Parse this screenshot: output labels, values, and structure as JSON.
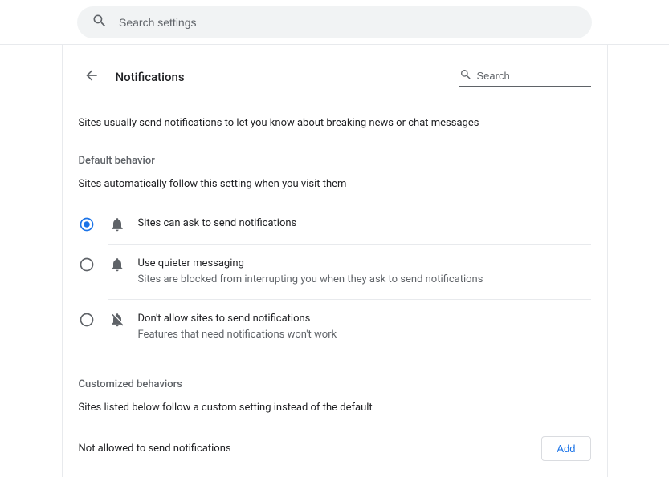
{
  "topSearch": {
    "placeholder": "Search settings"
  },
  "header": {
    "title": "Notifications",
    "searchPlaceholder": "Search"
  },
  "intro": "Sites usually send notifications to let you know about breaking news or chat messages",
  "defaultBehavior": {
    "title": "Default behavior",
    "subtitle": "Sites automatically follow this setting when you visit them",
    "options": [
      {
        "title": "Sites can ask to send notifications",
        "desc": "",
        "selected": true
      },
      {
        "title": "Use quieter messaging",
        "desc": "Sites are blocked from interrupting you when they ask to send notifications",
        "selected": false
      },
      {
        "title": "Don't allow sites to send notifications",
        "desc": "Features that need notifications won't work",
        "selected": false
      }
    ]
  },
  "customized": {
    "title": "Customized behaviors",
    "subtitle": "Sites listed below follow a custom setting instead of the default",
    "notAllowedLabel": "Not allowed to send notifications",
    "addLabel": "Add"
  },
  "colors": {
    "accent": "#1a73e8",
    "muted": "#5f6368"
  }
}
